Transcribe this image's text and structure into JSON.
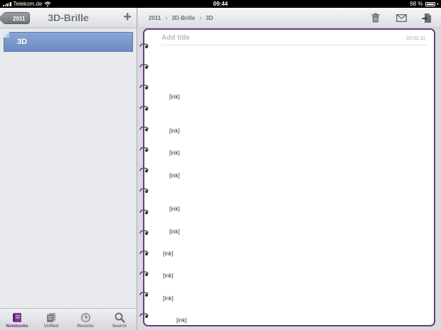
{
  "status": {
    "carrier": "Telekom.de",
    "time": "09:44",
    "battery": "98 %"
  },
  "sidebar": {
    "back_label": "2011",
    "title": "3D-Brille",
    "add_label": "+",
    "pages": [
      {
        "label": "3D"
      }
    ]
  },
  "tabs": [
    {
      "label": "Notebooks",
      "icon": "notebooks-icon"
    },
    {
      "label": "Unfiled",
      "icon": "unfiled-icon"
    },
    {
      "label": "Recents",
      "icon": "recents-icon"
    },
    {
      "label": "Search",
      "icon": "search-icon"
    }
  ],
  "toolbar": {
    "breadcrumb": [
      "2011",
      "3D-Brille",
      "3D"
    ],
    "icons": [
      "trash-icon",
      "mail-icon",
      "share-page-icon"
    ]
  },
  "page": {
    "title_placeholder": "Add title",
    "date": "03.02.11",
    "ink_items": [
      "[ink]",
      "[ink]",
      "[ink]",
      "[ink]",
      "[ink]",
      "[ink]",
      "[ink]",
      "[ink]",
      "[ink]",
      "[ink]"
    ]
  },
  "colors": {
    "accent": "#6d3c80",
    "selection": "#7a97cb",
    "toolbar_text": "#6b6f78"
  }
}
